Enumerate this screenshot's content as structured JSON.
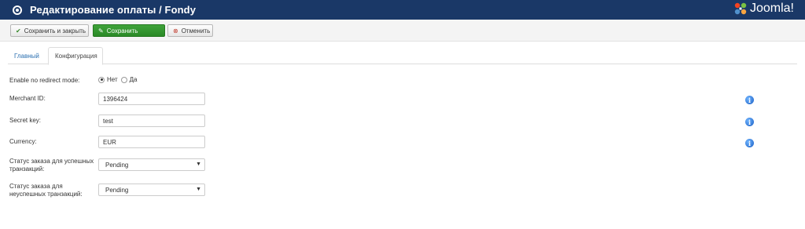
{
  "header": {
    "title": "Редактирование оплаты / Fondy",
    "logo_text": "Joomla!"
  },
  "toolbar": {
    "save_close_label": "Сохранить и закрыть",
    "save_label": "Сохранить",
    "cancel_label": "Отменить"
  },
  "tabs": [
    {
      "label": "Главный",
      "active": false
    },
    {
      "label": "Конфигурация",
      "active": true
    }
  ],
  "form": {
    "no_redirect": {
      "label": "Enable no redirect mode:",
      "options": [
        {
          "label": "Нет",
          "checked": true
        },
        {
          "label": "Да",
          "checked": false
        }
      ]
    },
    "merchant_id": {
      "label": "Merchant ID:",
      "value": "1396424"
    },
    "secret_key": {
      "label": "Secret key:",
      "value": "test"
    },
    "currency": {
      "label": "Currency:",
      "value": "EUR"
    },
    "success_status": {
      "label_line1": "Статус заказа для успешных",
      "label_line2": "транзакций:",
      "value": "Pending"
    },
    "fail_status": {
      "label_line1": "Статус заказа для",
      "label_line2": "неуспешных транзакций:",
      "value": "Pending"
    }
  },
  "colors": {
    "header_bg": "#1a3867",
    "save_button": "#2b8a27",
    "tab_link": "#2a6fb0",
    "info_icon": "#1b5fc4"
  },
  "icons": {
    "title": "radio-circle-icon",
    "save_close": "check-icon",
    "save": "edit-icon",
    "cancel": "cancel-circle-icon",
    "info": "info-icon"
  }
}
